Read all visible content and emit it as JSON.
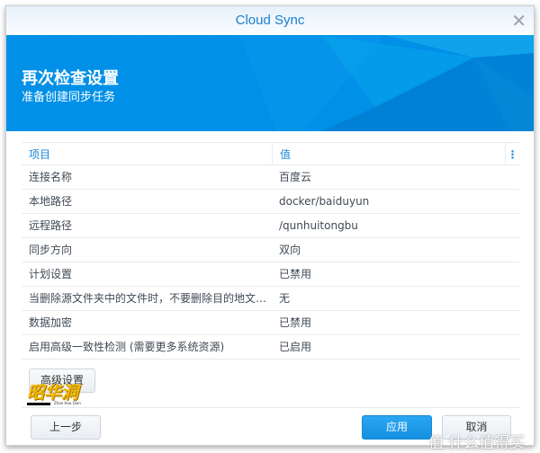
{
  "window": {
    "title": "Cloud Sync",
    "close_icon": "close-icon"
  },
  "banner": {
    "title": "再次检查设置",
    "subtitle": "准备创建同步任务"
  },
  "table": {
    "headers": [
      "项目",
      "值"
    ],
    "menu_icon": "⋮",
    "rows": [
      {
        "item": "连接名称",
        "value": "百度云"
      },
      {
        "item": "本地路径",
        "value": "docker/baiduyun"
      },
      {
        "item": "远程路径",
        "value": "/qunhuitongbu"
      },
      {
        "item": "同步方向",
        "value": "双向"
      },
      {
        "item": "计划设置",
        "value": "已禁用"
      },
      {
        "item": "当删除源文件夹中的文件时，不要删除目的地文…",
        "value": "无"
      },
      {
        "item": "数据加密",
        "value": "已禁用"
      },
      {
        "item": "启用高级一致性检测 (需要更多系统资源)",
        "value": "已启用"
      }
    ]
  },
  "buttons": {
    "advanced": "高级设置",
    "back": "上一步",
    "apply": "应用",
    "cancel": "取消"
  },
  "watermarks": {
    "logo1": "昭华洞",
    "logo1_sub": "Zhao Hua Dian",
    "logo2": "值 什么值得买"
  }
}
